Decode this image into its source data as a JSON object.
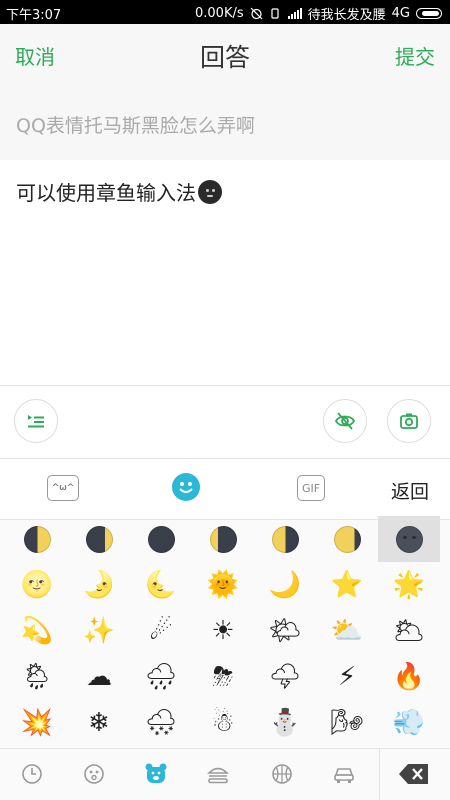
{
  "status_bar": {
    "time": "下午3:07",
    "speed": "0.00K/s",
    "carrier": "待我长发及腰",
    "network": "4G"
  },
  "header": {
    "cancel_label": "取消",
    "title": "回答",
    "submit_label": "提交"
  },
  "question": {
    "text": "QQ表情托马斯黑脸怎么弄啊"
  },
  "answer": {
    "text": "可以使用章鱼输入法"
  },
  "emoji_tabs": {
    "kaomoji_label": "^ω^",
    "gif_label": "GIF",
    "back_label": "返回"
  },
  "emoji_grid": {
    "rows": [
      [
        "first-quarter-moon",
        "waxing-crescent-moon",
        "new-moon",
        "waning-crescent-moon",
        "last-quarter-moon",
        "waning-gibbous-moon",
        "new-moon-face"
      ],
      [
        "🌝",
        "🌛",
        "🌜",
        "🌞",
        "🌙",
        "⭐",
        "🌟"
      ],
      [
        "💫",
        "✨",
        "☄",
        "☀",
        "🌤",
        "⛅",
        "🌥"
      ],
      [
        "🌦",
        "☁",
        "🌧",
        "⛈",
        "🌩",
        "⚡",
        "🔥"
      ],
      [
        "💥",
        "❄",
        "🌨",
        "☃",
        "⛄",
        "🌬",
        "💨"
      ]
    ],
    "selected": "new-moon-face"
  },
  "bottom_categories": [
    "recent-icon",
    "face-icon",
    "bear-icon",
    "food-icon",
    "ball-icon",
    "car-icon"
  ],
  "colors": {
    "accent_green": "#2eaa58",
    "emoji_tab_blue": "#2bb7d6",
    "header_bg": "#f7f7f7"
  }
}
